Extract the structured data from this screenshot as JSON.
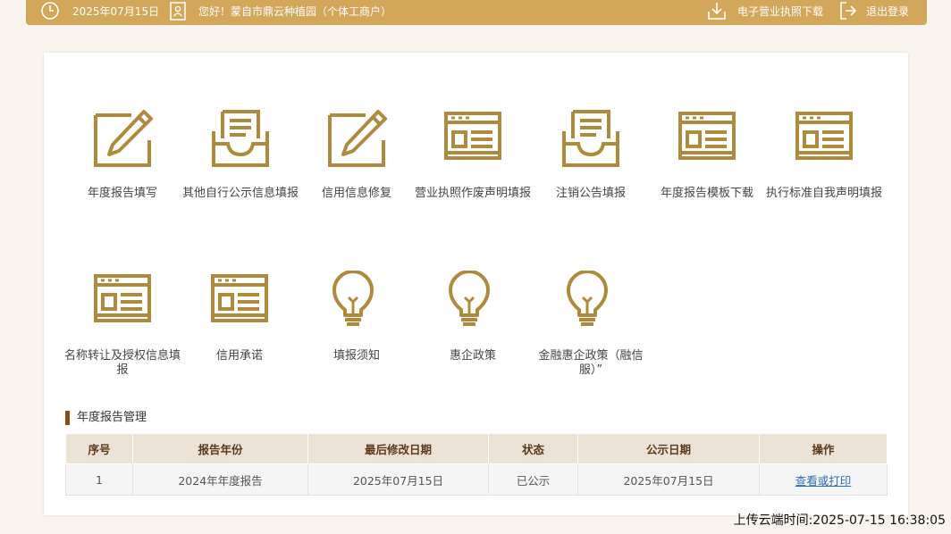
{
  "topbar": {
    "date": "2025年07月15日",
    "greeting": "您好！蒙自市鼎云种植园（个体工商户）",
    "download_license": "电子营业执照下载",
    "logout": "退出登录"
  },
  "tiles": [
    {
      "label": "年度报告填写",
      "icon": "pencil-edit-icon"
    },
    {
      "label": "其他自行公示信息填报",
      "icon": "inbox-document-icon"
    },
    {
      "label": "信用信息修复",
      "icon": "pencil-edit-icon"
    },
    {
      "label": "营业执照作废声明填报",
      "icon": "form-window-icon"
    },
    {
      "label": "注销公告填报",
      "icon": "inbox-document-icon"
    },
    {
      "label": "年度报告模板下载",
      "icon": "form-window-icon"
    },
    {
      "label": "执行标准自我声明填报",
      "icon": "form-window-icon"
    },
    {
      "label": "名称转让及授权信息填报",
      "icon": "form-window-icon"
    },
    {
      "label": "信用承诺",
      "icon": "form-window-icon"
    },
    {
      "label": "填报须知",
      "icon": "lightbulb-icon"
    },
    {
      "label": "惠企政策",
      "icon": "lightbulb-icon"
    },
    {
      "label": "金融惠企政策（融信服）”",
      "icon": "lightbulb-icon"
    }
  ],
  "section": {
    "title": "年度报告管理"
  },
  "table": {
    "headers": [
      "序号",
      "报告年份",
      "最后修改日期",
      "状态",
      "公示日期",
      "操作"
    ],
    "rows": [
      {
        "index": "1",
        "year": "2024年年度报告",
        "modified": "2025年07月15日",
        "status": "已公示",
        "published": "2025年07月15日",
        "action": "查看或打印"
      }
    ]
  },
  "footer": {
    "upload_time": "上传云端时间:2025-07-15 16:38:05"
  },
  "colors": {
    "gold": "#b08a3c",
    "topbar": "#d2a75a",
    "accent": "#8a4b13"
  }
}
